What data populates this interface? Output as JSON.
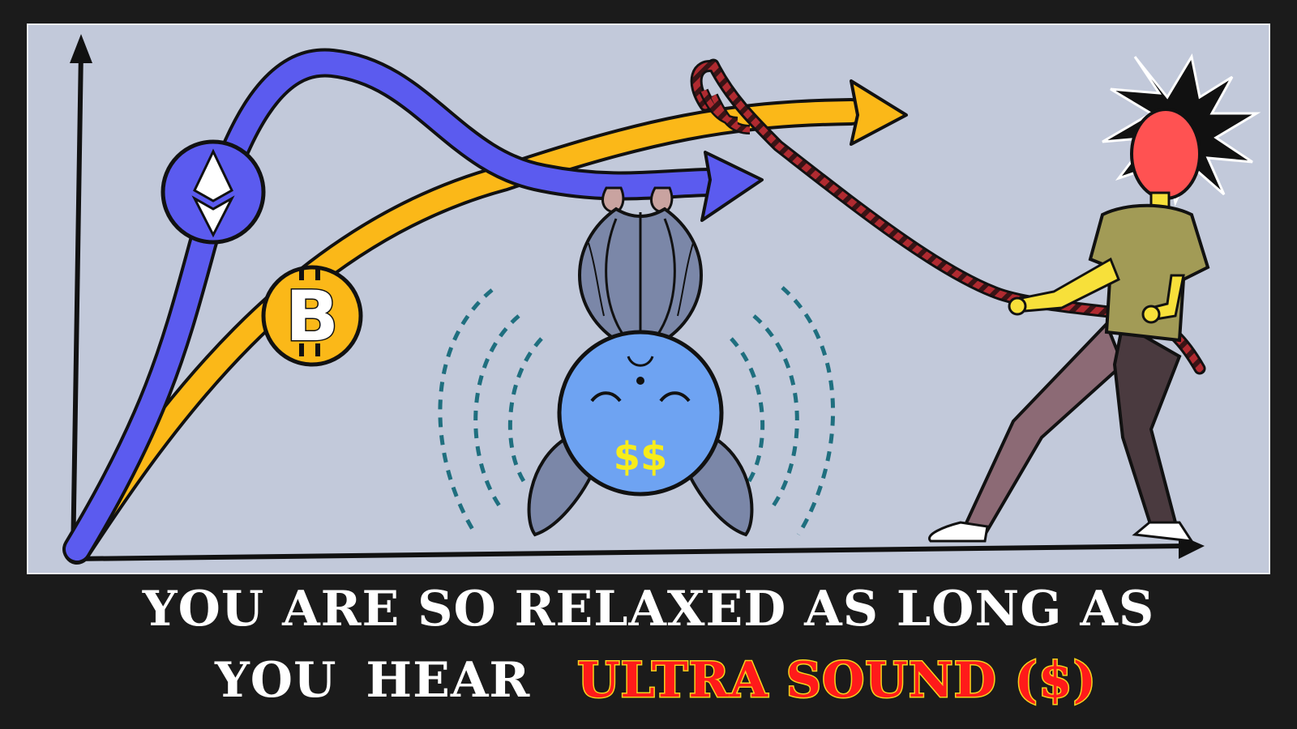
{
  "caption": {
    "line1": "YOU ARE SO RELAXED AS LONG AS",
    "line2_word1": "YOU",
    "line2_word2": "HEAR",
    "highlight": "ULTRA SOUND ($)"
  },
  "coins": {
    "eth_symbol": "ethereum-icon",
    "btc_symbol": "B"
  },
  "bat": {
    "belly_text": "$$"
  },
  "colors": {
    "background": "#1b1b1b",
    "panel": "#c2c9da",
    "eth_curve": "#5b5bef",
    "btc_curve": "#fbb818",
    "rope": "#b02a30",
    "highlight_text": "#ff1a1a",
    "highlight_outline": "#f7d21b"
  }
}
